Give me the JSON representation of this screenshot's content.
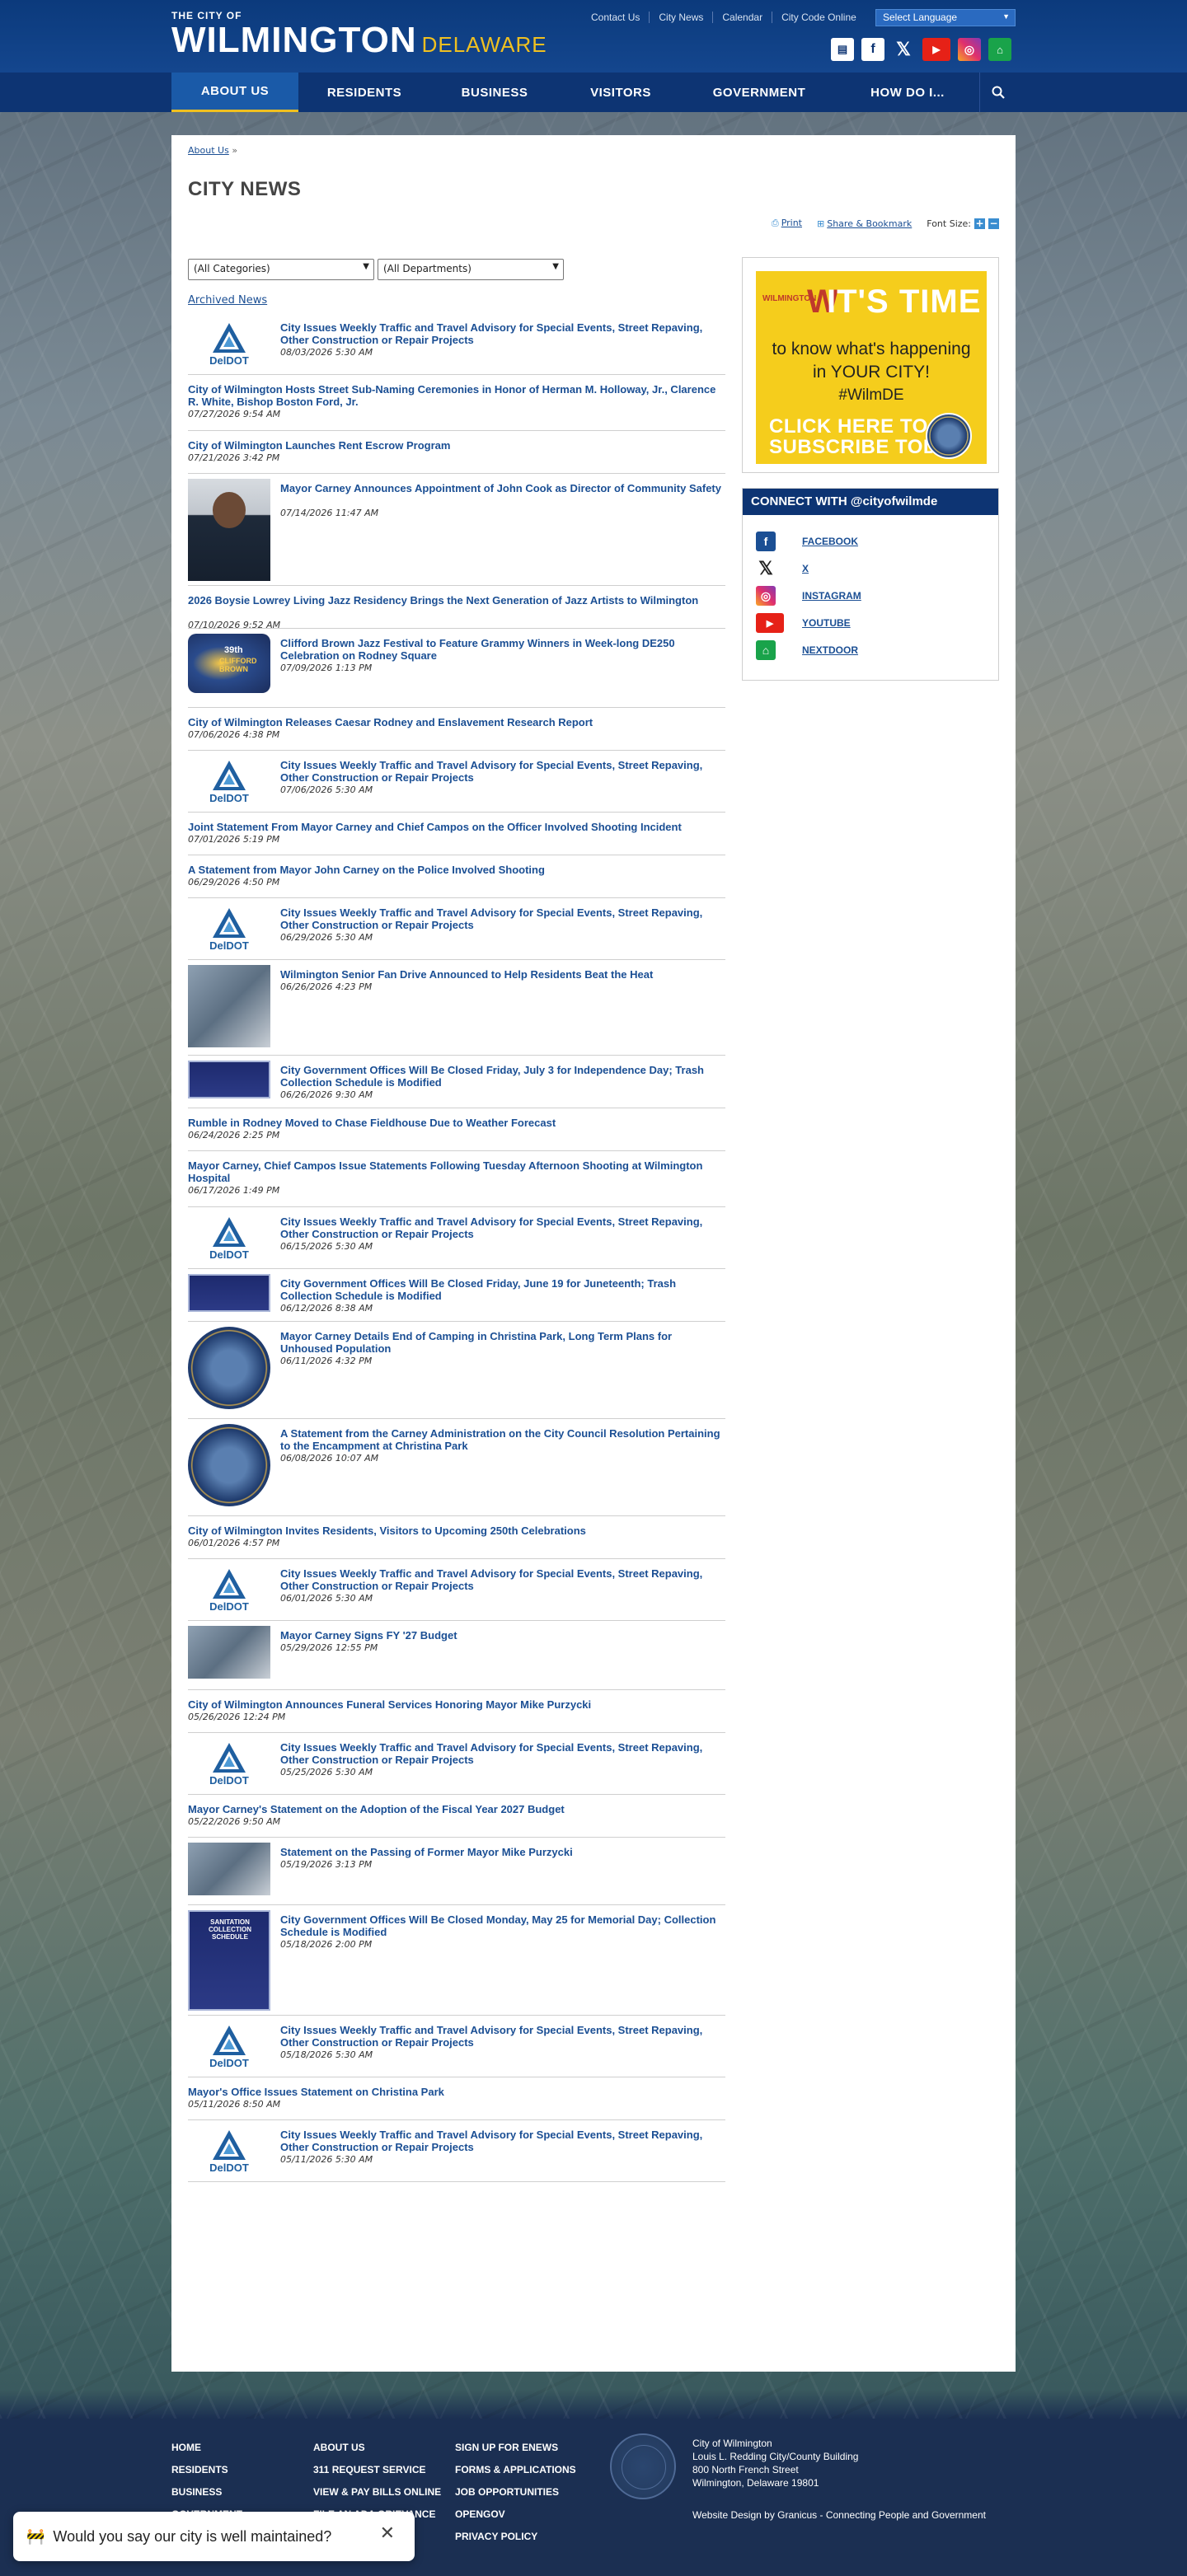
{
  "header": {
    "logo_small": "THE CITY OF",
    "logo_big": "WILMINGTON",
    "logo_state": "DELAWARE",
    "top_links": [
      "Contact Us",
      "City News",
      "Calendar",
      "City Code Online"
    ],
    "language_select": "Select Language"
  },
  "nav": {
    "items": [
      "ABOUT US",
      "RESIDENTS",
      "BUSINESS",
      "VISITORS",
      "GOVERNMENT",
      "HOW DO I..."
    ],
    "active": "ABOUT US",
    "active_color": "#1a5aa8",
    "accent_color": "#f0c020"
  },
  "breadcrumb": {
    "link": "About Us",
    "sep": "»"
  },
  "page_title": "CITY NEWS",
  "toolbar": {
    "print": "Print",
    "share": "Share & Bookmark",
    "font_size": "Font Size:",
    "plus": "+",
    "minus": "−"
  },
  "filters": {
    "categories": "(All Categories)",
    "departments": "(All Departments)"
  },
  "archived": "Archived News",
  "news": [
    {
      "title": "City Issues Weekly Traffic and Travel Advisory for Special Events, Street Repaving, Other Construction or Repair Projects",
      "date": "08/03/2026 5:30 AM",
      "thumb": "deldot"
    },
    {
      "title": "City of Wilmington Hosts Street Sub-Naming Ceremonies in Honor of Herman M. Holloway, Jr., Clarence R. White, Bishop Boston Ford, Jr.",
      "date": "07/27/2026 9:54 AM",
      "thumb": ""
    },
    {
      "title": "City of Wilmington Launches Rent Escrow Program",
      "date": "07/21/2026 3:42 PM",
      "thumb": ""
    },
    {
      "title": "Mayor Carney Announces Appointment of John Cook as Director of Community Safety",
      "date": "07/14/2026 11:47 AM",
      "thumb": "person"
    },
    {
      "title": "2026 Boysie Lowrey Living Jazz Residency Brings the Next Generation of Jazz Artists to Wilmington",
      "date": "07/10/2026 9:52 AM",
      "thumb": ""
    },
    {
      "title": "Clifford Brown Jazz Festival to Feature Grammy Winners in Week-long DE250 Celebration on Rodney Square",
      "date": "07/09/2026 1:13 PM",
      "thumb": "jazz"
    },
    {
      "title": "City of Wilmington Releases Caesar Rodney and Enslavement Research Report",
      "date": "07/06/2026 4:38 PM",
      "thumb": ""
    },
    {
      "title": "City Issues Weekly Traffic and Travel Advisory for Special Events, Street Repaving, Other Construction or Repair Projects",
      "date": "07/06/2026 5:30 AM",
      "thumb": "deldot"
    },
    {
      "title": "Joint Statement From Mayor Carney and Chief Campos on the Officer Involved Shooting Incident",
      "date": "07/01/2026 5:19 PM",
      "thumb": ""
    },
    {
      "title": "A Statement from Mayor John Carney on the Police Involved Shooting",
      "date": "06/29/2026 4:50 PM",
      "thumb": ""
    },
    {
      "title": "City Issues Weekly Traffic and Travel Advisory for Special Events, Street Repaving, Other Construction or Repair Projects",
      "date": "06/29/2026 5:30 AM",
      "thumb": "deldot"
    },
    {
      "title": "Wilmington Senior Fan Drive Announced to Help Residents Beat the Heat",
      "date": "06/26/2026 4:23 PM",
      "thumb": "photo"
    },
    {
      "title": "City Government Offices Will Be Closed Friday, July 3 for Independence Day; Trash Collection Schedule is Modified",
      "date": "06/26/2026 9:30 AM",
      "thumb": "banner"
    },
    {
      "title": "Rumble in Rodney Moved to Chase Fieldhouse Due to Weather Forecast",
      "date": "06/24/2026 2:25 PM",
      "thumb": ""
    },
    {
      "title": "Mayor Carney, Chief Campos Issue Statements Following Tuesday Afternoon Shooting at Wilmington Hospital",
      "date": "06/17/2026 1:49 PM",
      "thumb": ""
    },
    {
      "title": "City Issues Weekly Traffic and Travel Advisory for Special Events, Street Repaving, Other Construction or Repair Projects",
      "date": "06/15/2026 5:30 AM",
      "thumb": "deldot"
    },
    {
      "title": "City Government Offices Will Be Closed Friday, June 19 for Juneteenth; Trash Collection Schedule is Modified",
      "date": "06/12/2026 8:38 AM",
      "thumb": "banner"
    },
    {
      "title": "Mayor Carney Details End of Camping in Christina Park, Long Term Plans for Unhoused Population",
      "date": "06/11/2026 4:32 PM",
      "thumb": "seal"
    },
    {
      "title": "A Statement from the Carney Administration on the City Council Resolution Pertaining to the Encampment at Christina Park",
      "date": "06/08/2026 10:07 AM",
      "thumb": "seal"
    },
    {
      "title": "City of Wilmington Invites Residents, Visitors to Upcoming 250th Celebrations",
      "date": "06/01/2026 4:57 PM",
      "thumb": ""
    },
    {
      "title": "City Issues Weekly Traffic and Travel Advisory for Special Events, Street Repaving, Other Construction or Repair Projects",
      "date": "06/01/2026 5:30 AM",
      "thumb": "deldot"
    },
    {
      "title": "Mayor Carney Signs FY '27 Budget",
      "date": "05/29/2026 12:55 PM",
      "thumb": "photo"
    },
    {
      "title": "City of Wilmington Announces Funeral Services Honoring Mayor Mike Purzycki",
      "date": "05/26/2026 12:24 PM",
      "thumb": ""
    },
    {
      "title": "City Issues Weekly Traffic and Travel Advisory for Special Events, Street Repaving, Other Construction or Repair Projects",
      "date": "05/25/2026 5:30 AM",
      "thumb": "deldot"
    },
    {
      "title": "Mayor Carney's Statement on the Adoption of the Fiscal Year 2027 Budget",
      "date": "05/22/2026 9:50 AM",
      "thumb": ""
    },
    {
      "title": "Statement on the Passing of Former Mayor Mike Purzycki",
      "date": "05/19/2026 3:13 PM",
      "thumb": "photo"
    },
    {
      "title": "City Government Offices Will Be Closed Monday, May 25 for Memorial Day; Collection Schedule is Modified",
      "date": "05/18/2026 2:00 PM",
      "thumb": "flyer"
    },
    {
      "title": "City Issues Weekly Traffic and Travel Advisory for Special Events, Street Repaving, Other Construction or Repair Projects",
      "date": "05/18/2026 5:30 AM",
      "thumb": "deldot"
    },
    {
      "title": "Mayor's Office Issues Statement on Christina Park",
      "date": "05/11/2026 8:50 AM",
      "thumb": ""
    },
    {
      "title": "City Issues Weekly Traffic and Travel Advisory for Special Events, Street Repaving, Other Construction or Repair Projects",
      "date": "05/11/2026 5:30 AM",
      "thumb": "deldot"
    }
  ],
  "deldot_label": "DelDOT",
  "jazz_thumb": {
    "edition": "39th",
    "name": "CLIFFORD BROWN"
  },
  "flyer_thumb": {
    "heading": "SANITATION COLLECTION SCHEDULE"
  },
  "promo": {
    "brand": "WILMINGTON",
    "headline": "IT'S TIME",
    "line1": "to know what's happening",
    "line2": "in YOUR CITY!",
    "hashtag": "#WilmDE",
    "cta1": "CLICK HERE TO",
    "cta2": "SUBSCRIBE TODAY",
    "color": "#f5cd1c"
  },
  "connect": {
    "heading": "CONNECT WITH @cityofwilmde",
    "items": [
      "FACEBOOK",
      "X",
      "INSTAGRAM",
      "YOUTUBE",
      "NEXTDOOR"
    ]
  },
  "footer": {
    "col1": [
      "HOME",
      "RESIDENTS",
      "BUSINESS",
      "GOVERNMENT"
    ],
    "col2": [
      "ABOUT US",
      "311 REQUEST SERVICE",
      "VIEW & PAY BILLS ONLINE",
      "FILE AN ADA GRIEVANCE"
    ],
    "col3": [
      "SIGN UP FOR ENEWS",
      "FORMS & APPLICATIONS",
      "JOB OPPORTUNITIES",
      "OPENGOV",
      "PRIVACY POLICY"
    ],
    "address": [
      "City of Wilmington",
      "Louis L. Redding City/County Building",
      "800 North French Street",
      "Wilmington, Delaware 19801"
    ],
    "credit": "Website Design by Granicus - Connecting People and Government"
  },
  "survey": {
    "emoji": "🚧",
    "question": "Would you say our city is well maintained?"
  }
}
